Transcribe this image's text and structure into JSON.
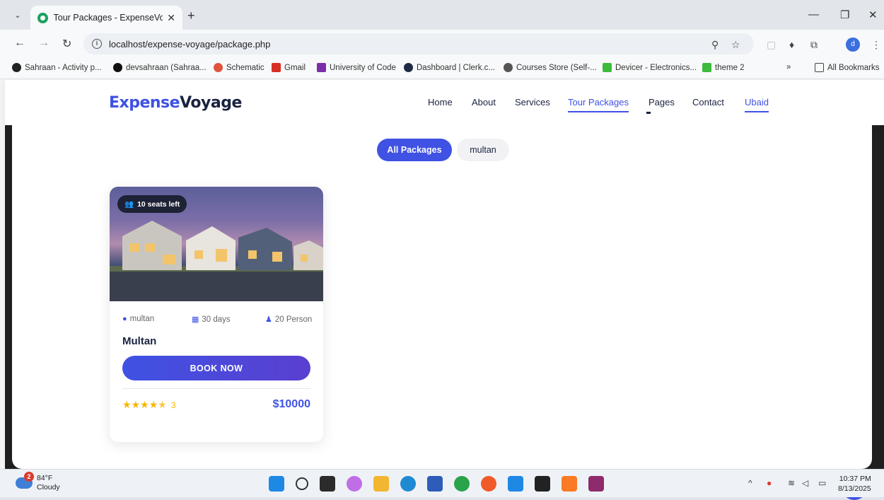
{
  "browser": {
    "tab_title": "Tour Packages - ExpenseVoyage",
    "url": "localhost/expense-voyage/package.php",
    "bookmarks": [
      "Sahraan - Activity p...",
      "devsahraan (Sahraa...",
      "Schematic",
      "Gmail",
      "University of Code",
      "Dashboard | Clerk.c...",
      "Courses Store (Self-...",
      "Devicer - Electronics...",
      "theme 2"
    ],
    "all_bookmarks": "All Bookmarks",
    "profile_initial": "d"
  },
  "site": {
    "logo_part1": "Expense",
    "logo_part2": "Voyage",
    "nav": [
      "Home",
      "About",
      "Services",
      "Tour Packages",
      "Pages",
      "Contact",
      "Ubaid"
    ],
    "filters": [
      "All Packages",
      "multan"
    ]
  },
  "card": {
    "seats_badge": "10 seats left",
    "location": "multan",
    "duration": "30 days",
    "persons": "20 Person",
    "title": "Multan",
    "button": "BOOK NOW",
    "rating_count": "3",
    "rating": 4.5,
    "price": "$10000"
  },
  "taskbar": {
    "temp": "84°F",
    "condition": "Cloudy",
    "weather_badge": "2",
    "time": "10:37 PM",
    "date": "8/13/2025"
  },
  "colors": {
    "accent": "#3f52e3",
    "dark": "#1a2341",
    "star": "#f7b500"
  }
}
